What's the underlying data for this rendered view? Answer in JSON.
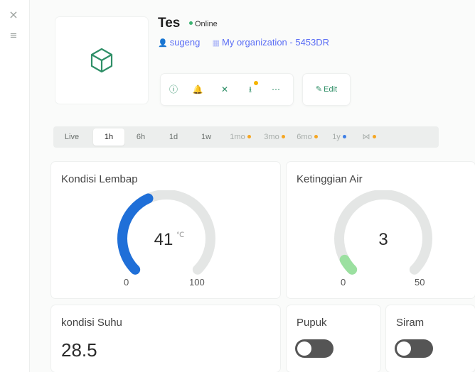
{
  "rail": {
    "close_icon": "×",
    "menu_icon": "≡"
  },
  "device": {
    "title": "Tes",
    "status": "Online",
    "status_color": "#3cb371",
    "owner": "sugeng",
    "organization": "My organization - 5453DR",
    "icon": "cube-icon"
  },
  "toolbar": {
    "items": [
      {
        "name": "info-icon",
        "glyph": "ⓘ"
      },
      {
        "name": "bell-icon",
        "glyph": "🔔"
      },
      {
        "name": "tools-icon",
        "glyph": "✕"
      },
      {
        "name": "download-icon",
        "glyph": "⭳"
      },
      {
        "name": "more-icon",
        "glyph": "⋯"
      }
    ],
    "edit_label": "Edit"
  },
  "ranges": [
    {
      "label": "Live",
      "state": "normal"
    },
    {
      "label": "1h",
      "state": "active"
    },
    {
      "label": "6h",
      "state": "normal"
    },
    {
      "label": "1d",
      "state": "normal"
    },
    {
      "label": "1w",
      "state": "normal"
    },
    {
      "label": "1mo",
      "state": "locked",
      "dot": "#f5a623"
    },
    {
      "label": "3mo",
      "state": "locked",
      "dot": "#f5a623"
    },
    {
      "label": "6mo",
      "state": "locked",
      "dot": "#f5a623"
    },
    {
      "label": "1y",
      "state": "locked",
      "dot": "#3f7fe6"
    },
    {
      "label": "⋈",
      "state": "locked",
      "dot": "#f5a623"
    }
  ],
  "widgets": {
    "lembap": {
      "title": "Kondisi Lembap",
      "value": "41",
      "unit": "℃",
      "min": "0",
      "max": "100",
      "fraction": 0.41,
      "color": "#1f6fd8"
    },
    "air": {
      "title": "Ketinggian Air",
      "value": "3",
      "min": "0",
      "max": "50",
      "fraction": 0.06,
      "color": "#9be0a0"
    },
    "suhu": {
      "title": "kondisi Suhu",
      "value": "28.5"
    },
    "pupuk": {
      "title": "Pupuk",
      "on": false
    },
    "siram": {
      "title": "Siram",
      "on": false
    }
  }
}
